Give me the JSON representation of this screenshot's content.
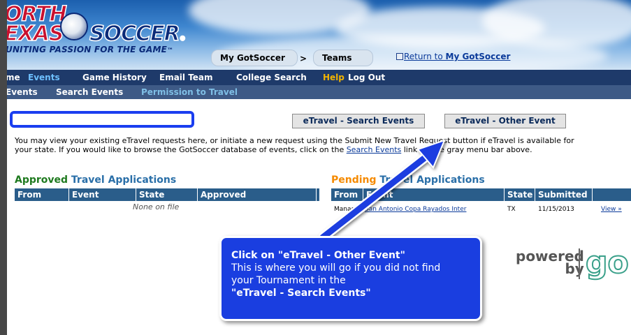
{
  "header": {
    "logo_line1": "ORTH",
    "logo_line2": "EXAS",
    "logo_soccer": "SOCCER",
    "logo_tm": "®",
    "logo_tagline": "UNITING PASSION FOR THE GAME",
    "logo_tagline_tm": "™",
    "breadcrumb": {
      "item1": "My GotSoccer",
      "sep": ">",
      "item2": "Teams"
    },
    "return_link_prefix": "Return to ",
    "return_link_bold": "My GotSoccer"
  },
  "nav_main": {
    "items": [
      {
        "label": "me"
      },
      {
        "label": "Events"
      },
      {
        "label": "Game History"
      },
      {
        "label": "Email Team"
      },
      {
        "label": "College Search"
      },
      {
        "label": "Help"
      },
      {
        "label": "Log Out"
      }
    ]
  },
  "nav_sub": {
    "items": [
      {
        "label": "Events"
      },
      {
        "label": "Search Events"
      },
      {
        "label": "Permission to Travel"
      }
    ]
  },
  "actions": {
    "search_events_label": "eTravel - Search Events",
    "other_event_label": "eTravel - Other Event"
  },
  "intro": {
    "text1": "You may view your existing eTravel requests here, or initiate a new request using the Submit New Travel Request button if eTravel is available for your state. If you would like to browse the GotSoccer database of events, click on the ",
    "link": "Search Events",
    "text2": " link on the gray menu bar above."
  },
  "approved": {
    "title_colored": "Approved",
    "title_rest": "Travel Applications",
    "columns": [
      "From",
      "Event",
      "State",
      "Approved"
    ],
    "empty_text": "None on file"
  },
  "pending": {
    "title_colored": "Pending",
    "title_rest": "Travel Applications",
    "columns": [
      "From",
      "Event",
      "State",
      "Submitted"
    ],
    "row": {
      "from": "Manag",
      "event": "San Antonio Copa Rayados Inter",
      "state": "TX",
      "submitted": "11/15/2013",
      "view": "View »"
    }
  },
  "callout": {
    "line1": "Click on  \"eTravel - Other Event\"",
    "line2": "This is where you will go if you did not find",
    "line3": "your Tournament in the",
    "line4": "\"eTravel - Search Events\""
  },
  "powered": {
    "line1": "powered",
    "line2": "by",
    "logo": "go"
  },
  "colors": {
    "nav_main_bg": "#1e3a6a",
    "nav_sub_bg": "#3e5a86",
    "table_header_bg": "#2a5d8a",
    "callout_bg": "#1a3ee0",
    "approved_green": "#1f7a1f",
    "pending_orange": "#f58a00",
    "help_yellow": "#f2b300"
  },
  "icons": {
    "return_icon": "external-link-icon",
    "soccer_ball": "soccer-ball-icon",
    "arrow": "callout-arrow"
  }
}
